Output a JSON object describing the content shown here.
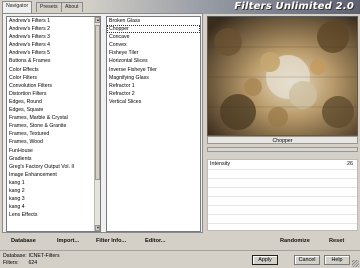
{
  "app": {
    "title": "Filters Unlimited 2.0"
  },
  "tabs": [
    {
      "label": "Navigator"
    },
    {
      "label": "Presets"
    },
    {
      "label": "About"
    }
  ],
  "categories": {
    "items": [
      "Andrew's Filters 1",
      "Andrew's Filters 2",
      "Andrew's Filters 3",
      "Andrew's Filters 4",
      "Andrew's Filters 5",
      "Buttons & Frames",
      "Color Effects",
      "Color Filters",
      "Convolution Filters",
      "Distortion Filters",
      "Edges, Round",
      "Edges, Square",
      "Frames, Marble & Crystal",
      "Frames, Stone & Granite",
      "Frames, Textured",
      "Frames, Wood",
      "FunHouse",
      "Gradients",
      "Greg's Factory Output Vol. II",
      "Image Enhancement",
      "kang 1",
      "kang 2",
      "kang 3",
      "kang 4",
      "Lens Effects"
    ]
  },
  "filters": {
    "items": [
      "Broken Glass",
      "Chopper",
      "Concave",
      "Convex",
      "Fisheye Tiler",
      "Horizontal Slices",
      "Inverse Fisheye Tiler",
      "Magnifying Glass",
      "Refractor 1",
      "Refractor 2",
      "Vertical Slices"
    ],
    "selected": "Chopper"
  },
  "bottom_links": {
    "database": "Database",
    "import": "Import...",
    "filter_info": "Filter Info...",
    "editor": "Editor...",
    "randomize": "Randomize",
    "reset": "Reset"
  },
  "preview": {
    "caption": "Chopper"
  },
  "parameters": [
    {
      "label": "Intensity",
      "value": "26"
    }
  ],
  "status": {
    "database_key": "Database:",
    "database_value": "ICNET-Filters",
    "filters_key": "Filters:",
    "filters_value": "624"
  },
  "dialog_buttons": {
    "apply": "Apply",
    "cancel": "Cancel",
    "help": "Help"
  },
  "colors": {
    "selection": "#0a246a",
    "banner_dark": "#5c6070",
    "face": "#d4d0c8"
  }
}
